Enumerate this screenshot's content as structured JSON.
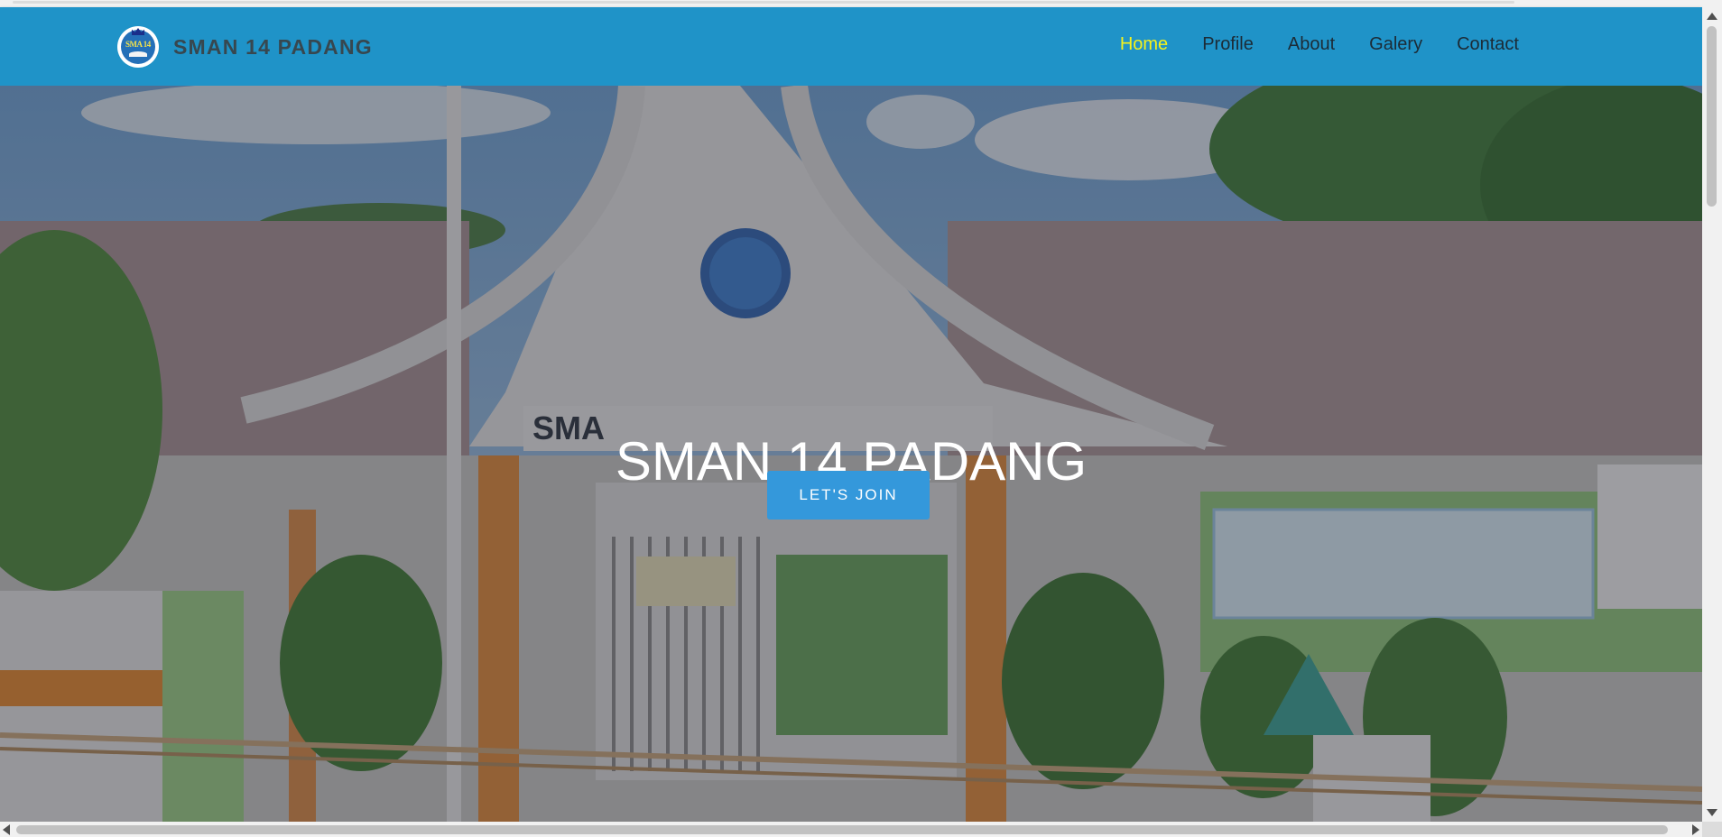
{
  "navbar": {
    "brand": {
      "name": "SMAN 14 PADANG",
      "logo_text": "SMA 14"
    },
    "links": [
      {
        "label": "Home",
        "active": true
      },
      {
        "label": "Profile",
        "active": false
      },
      {
        "label": "About",
        "active": false
      },
      {
        "label": "Galery",
        "active": false
      },
      {
        "label": "Contact",
        "active": false
      }
    ]
  },
  "hero": {
    "title": "SMAN 14 PADANG",
    "button_label": "LET'S JOIN",
    "background": "school-building-photo"
  },
  "colors": {
    "navbar_bg": "#1f93c8",
    "brand_text": "#37474f",
    "nav_link": "#1c2b36",
    "nav_active": "#f5f21b",
    "button_bg": "#3498db"
  }
}
